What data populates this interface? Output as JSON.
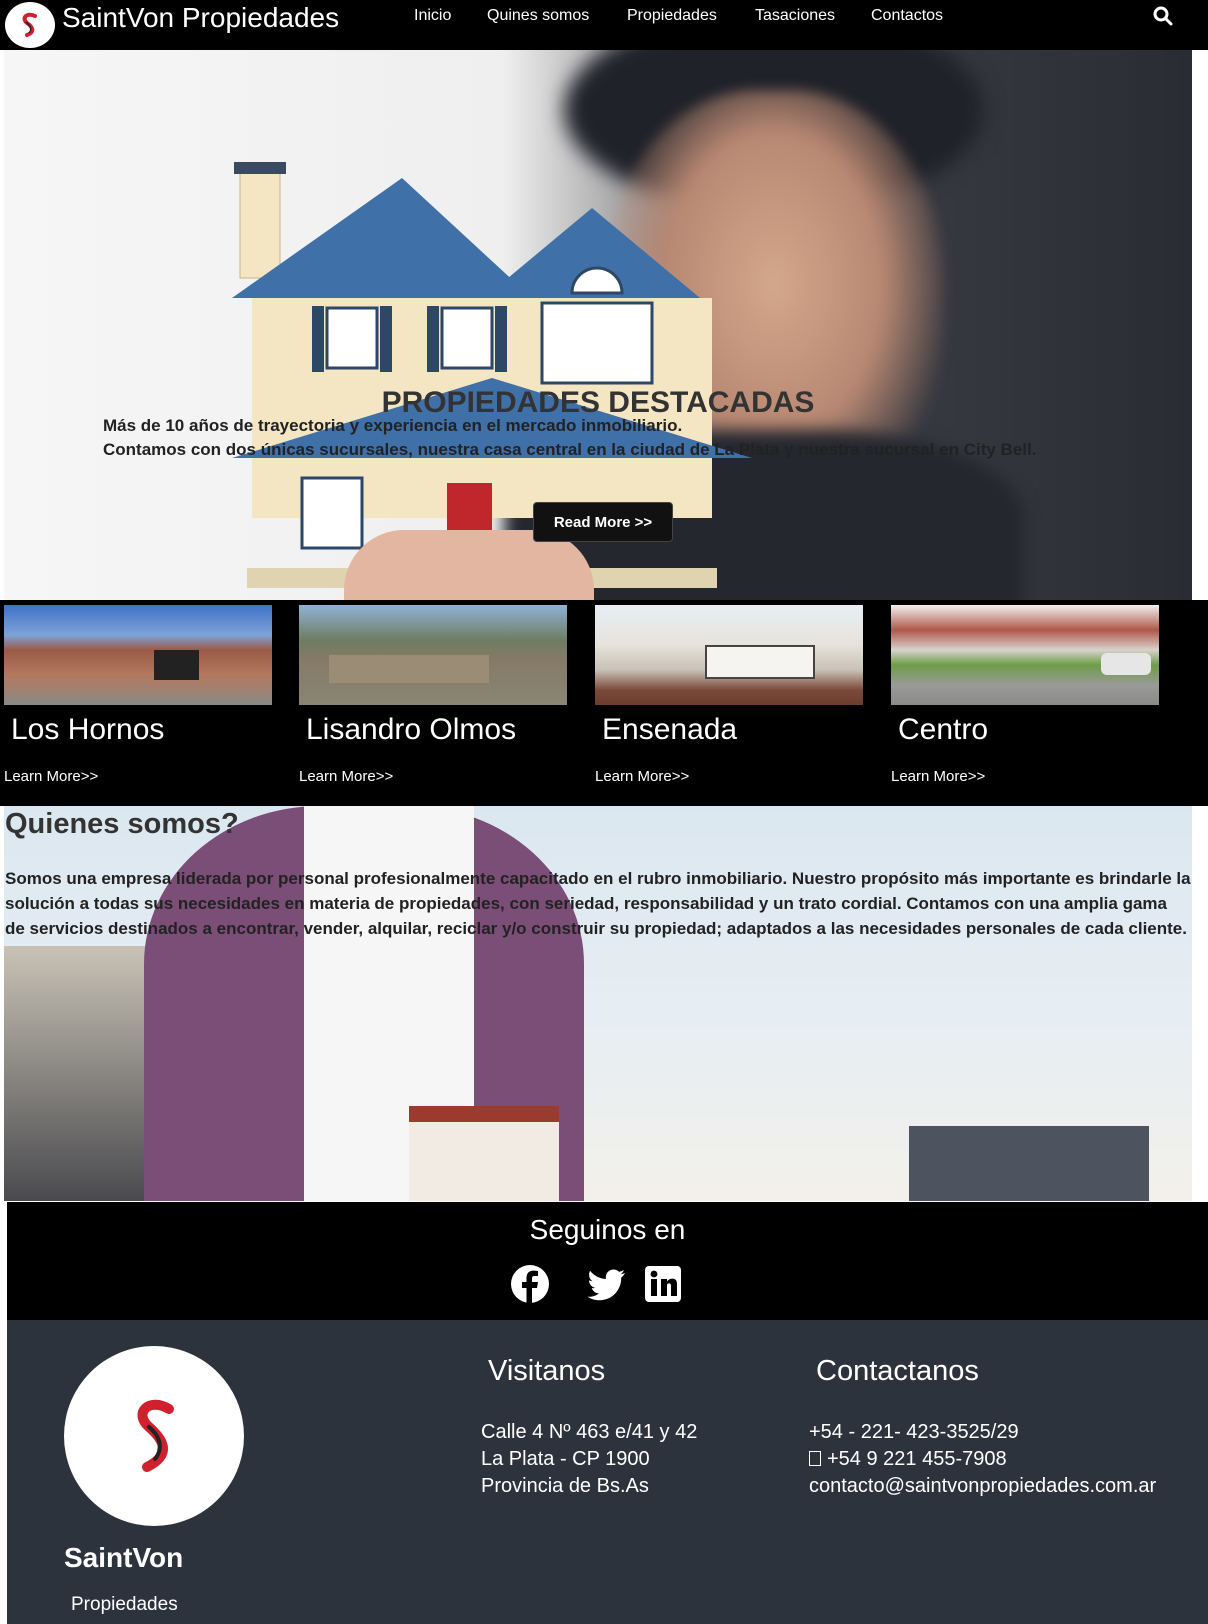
{
  "navbar": {
    "brand": "SaintVon  Propiedades",
    "links": [
      "Inicio",
      "Quines somos",
      "Propiedades",
      "Tasaciones",
      "Contactos"
    ],
    "search_icon": "search-icon"
  },
  "hero": {
    "title": "PROPIEDADES DESTACADAS",
    "line1": "Más de 10 años de trayectoria y experiencia en el mercado inmobiliario.",
    "line2": "Contamos con dos únicas sucursales, nuestra casa central en la ciudad de La Plata y nuestra sucursal en City Bell.",
    "button": "Read More >>"
  },
  "properties": [
    {
      "name": "Los Hornos",
      "link": "Learn More>>"
    },
    {
      "name": "Lisandro Olmos",
      "link": "Learn More>>"
    },
    {
      "name": "Ensenada",
      "link": "Learn More>>"
    },
    {
      "name": "Centro",
      "link": "Learn More>>"
    }
  ],
  "about": {
    "title": "Quienes somos?",
    "text": "Somos una empresa liderada por personal profesionalmente capacitado en el rubro inmobiliario. Nuestro propósito más importante es brindarle la solución a todas sus necesidades en materia de propiedades, con seriedad, responsabilidad y un trato cordial. Contamos con una amplia gama de servicios destinados a encontrar, vender, alquilar, reciclar y/o construir su propiedad; adaptados a las necesidades personales de cada cliente."
  },
  "social": {
    "title": "Seguinos en",
    "icons": [
      "facebook-icon",
      "twitter-icon",
      "linkedin-icon"
    ]
  },
  "footer": {
    "brand": "SaintVon",
    "sub": "Propiedades",
    "visit_title": "Visitanos",
    "address": [
      "Calle 4 Nº 463 e/41 y 42",
      "La Plata - CP 1900",
      "Provincia de Bs.As"
    ],
    "contact_title": "Contactanos",
    "phone": "+54 - 221- 423-3525/29",
    "whatsapp": "+54 9 221 455-7908",
    "email": "contacto@saintvonpropiedades.com.ar"
  },
  "colors": {
    "navbar": "#000000",
    "footer": "#2d333d",
    "logo_red": "#d0202e"
  }
}
